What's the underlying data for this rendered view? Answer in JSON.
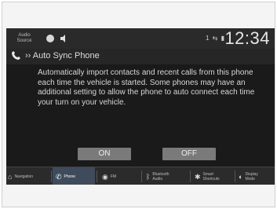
{
  "statusbar": {
    "audio_source": "Audio Source",
    "time": "12:34",
    "status_icons": "1 ⇆ ▮"
  },
  "titlebar": {
    "breadcrumb_arrow": "››",
    "title": "Auto Sync Phone"
  },
  "message": "Automatically import contacts and recent calls from this phone each time the vehicle is started. Some phones may have an additional setting to allow the phone to auto connect each time your turn on your vehicle.",
  "buttons": {
    "on": "ON",
    "off": "OFF"
  },
  "nav": {
    "items": [
      {
        "label": "Navigation",
        "icon": "navigation-icon"
      },
      {
        "label": "Phone",
        "icon": "phone-icon",
        "active": true
      },
      {
        "label": "FM",
        "icon": "radio-icon"
      },
      {
        "label": "Bluetooth Audio",
        "icon": "bluetooth-icon"
      },
      {
        "label": "Smart Shortcuts",
        "icon": "smart-shortcuts-icon"
      },
      {
        "label": "Display Mode",
        "icon": "display-mode-icon"
      }
    ]
  },
  "colors": {
    "screen_bg": "#1a1a1a",
    "button_bg": "#7a7a7a",
    "active_nav_bg": "#3e4b5a"
  }
}
